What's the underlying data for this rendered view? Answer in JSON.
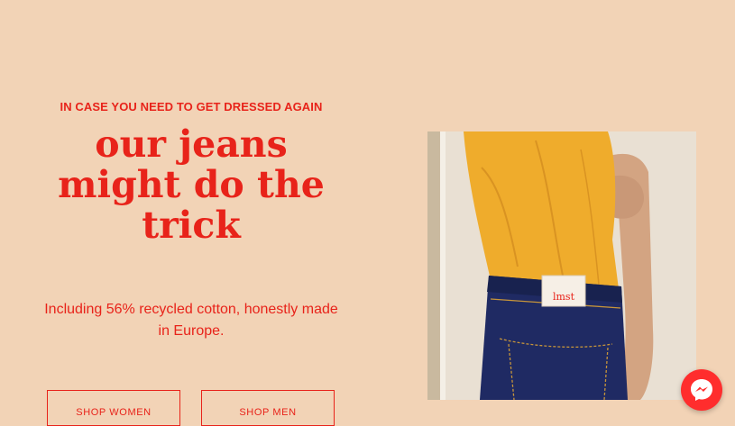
{
  "hero": {
    "eyebrow": "IN CASE YOU NEED TO GET DRESSED AGAIN",
    "headline_lines": [
      "our jeans",
      "might do the",
      "trick"
    ],
    "subcopy_line1": "Including 56% recycled cotton, honestly made",
    "subcopy_line2": "in Europe.",
    "buttons": {
      "women": "SHOP WOMEN",
      "men": "SHOP MEN"
    }
  },
  "image": {
    "label_text": "lmst"
  },
  "chat": {
    "icon": "messenger-icon"
  },
  "colors": {
    "background": "#f2d3b6",
    "accent": "#e8231a",
    "chat_button": "#ff2d2d"
  }
}
